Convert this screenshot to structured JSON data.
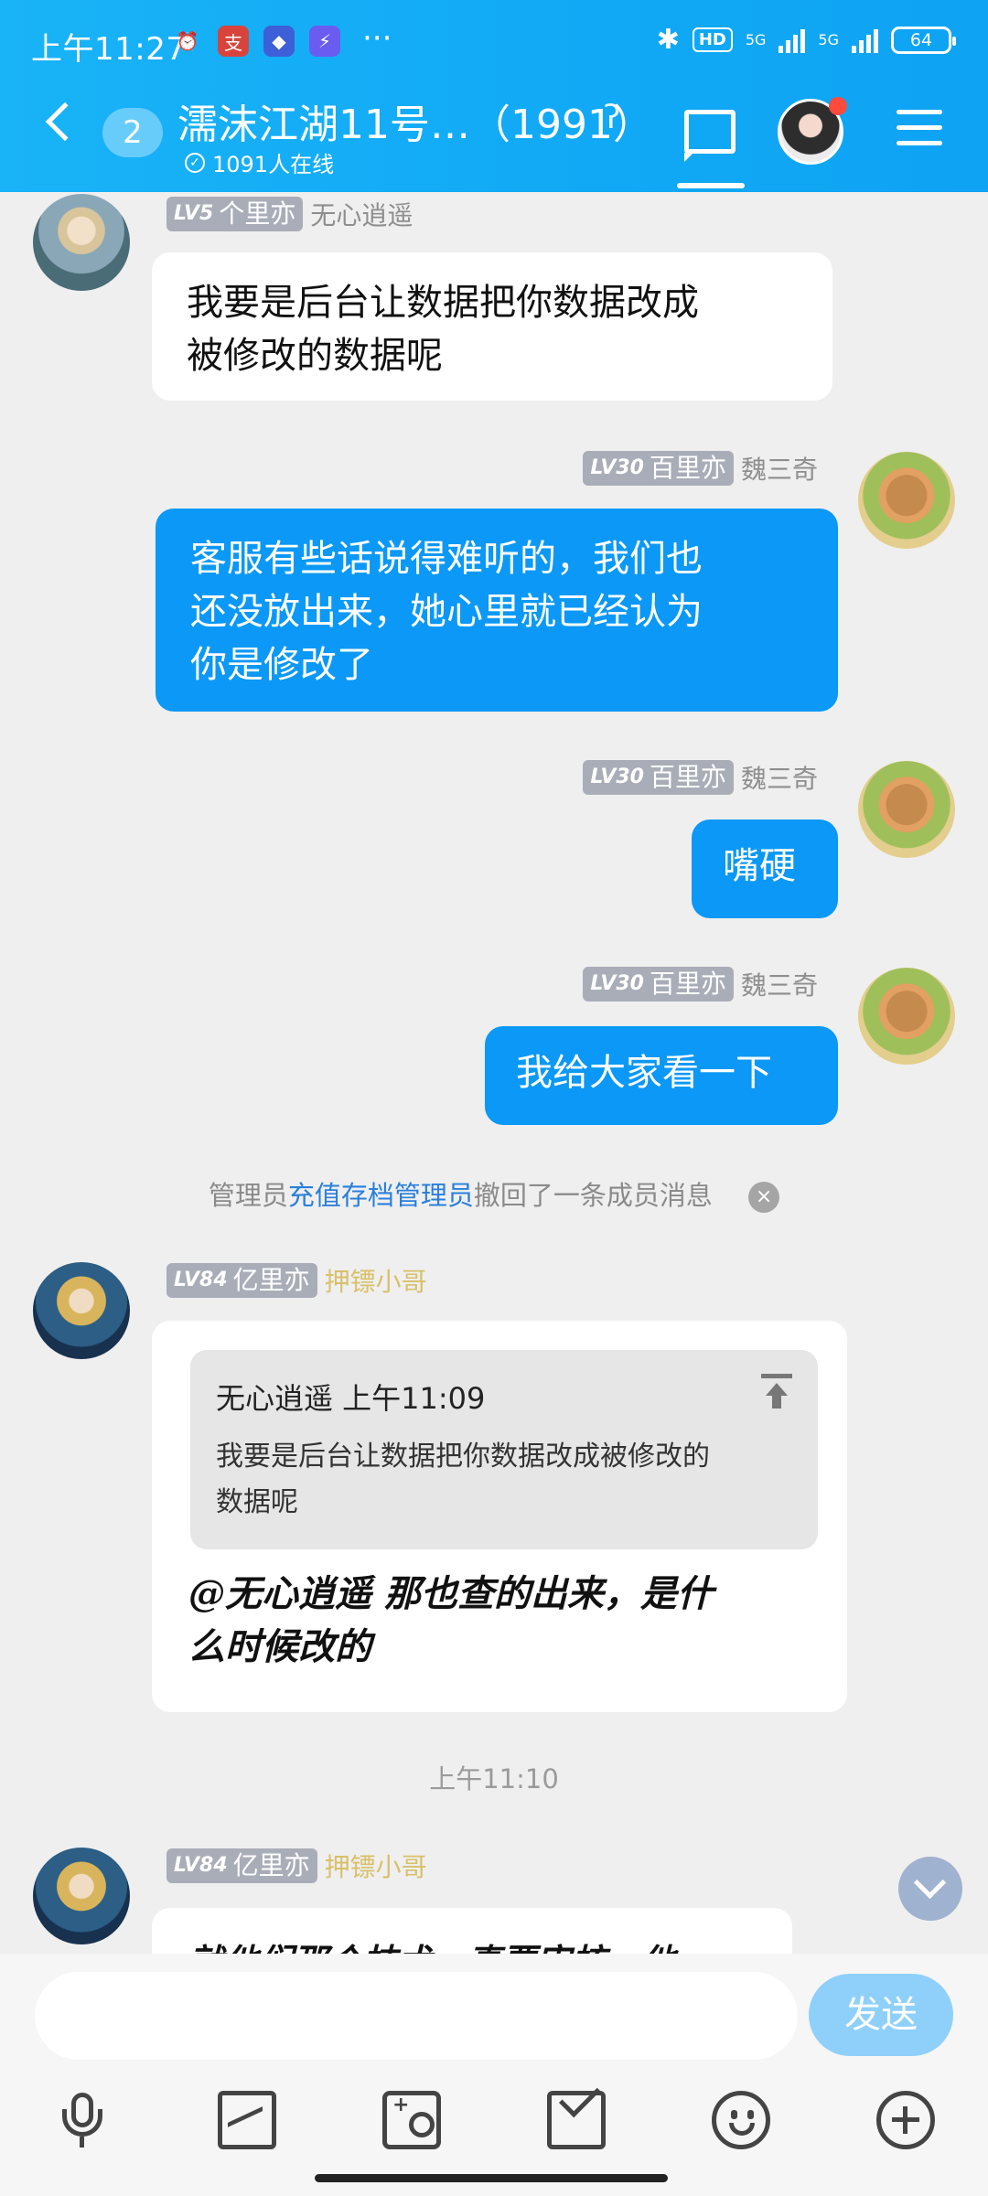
{
  "status_bar": {
    "time": "上午11:27",
    "network_1": "5G",
    "network_2": "5G",
    "hd": "HD",
    "battery": "64"
  },
  "header": {
    "unread_count": "2",
    "group_title": "濡沫江湖11号…（1991）",
    "online_text": "1091人在线"
  },
  "messages": [
    {
      "side": "left",
      "level": "LV5",
      "title": "个里亦",
      "name": "无心逍遥",
      "text_line1": "我要是后台让数据把你数据改成",
      "text_line2": "被修改的数据呢"
    },
    {
      "side": "right",
      "level": "LV30",
      "title": "百里亦",
      "name": "魏三奇",
      "text_line1": "客服有些话说得难听的，我们也",
      "text_line2": "还没放出来，她心里就已经认为",
      "text_line3": "你是修改了"
    },
    {
      "side": "right",
      "level": "LV30",
      "title": "百里亦",
      "name": "魏三奇",
      "text_line1": "嘴硬"
    },
    {
      "side": "right",
      "level": "LV30",
      "title": "百里亦",
      "name": "魏三奇",
      "text_line1": "我给大家看一下"
    }
  ],
  "system_notice": {
    "prefix": "管理员",
    "link": "充值存档管理员",
    "suffix": "撤回了一条成员消息",
    "close": "×"
  },
  "reply_message": {
    "level": "LV84",
    "title": "亿里亦",
    "name": "押镖小哥",
    "quote_author_time": "无心逍遥 上午11:09",
    "quote_line1": "我要是后台让数据把你数据改成被修改的",
    "quote_line2": "数据呢",
    "text_line1": "@无心逍遥 那也查的出来，是什",
    "text_line2": "么时候改的"
  },
  "timestamp": "上午11:10",
  "last_message": {
    "level": "LV84",
    "title": "亿里亦",
    "name": "押镖小哥",
    "partial_text": "就他们那个技术，真要审核，他"
  },
  "input": {
    "placeholder": "",
    "send_label": "发送"
  },
  "icons": {
    "toolbar": [
      "mic-icon",
      "image-icon",
      "camera-icon",
      "red-packet-icon",
      "emoji-icon",
      "plus-icon"
    ]
  },
  "colors": {
    "header": "#11a9f5",
    "bubble_self": "#0b98f6",
    "send_button": "#8fd0fb",
    "link": "#2a7fdc"
  }
}
